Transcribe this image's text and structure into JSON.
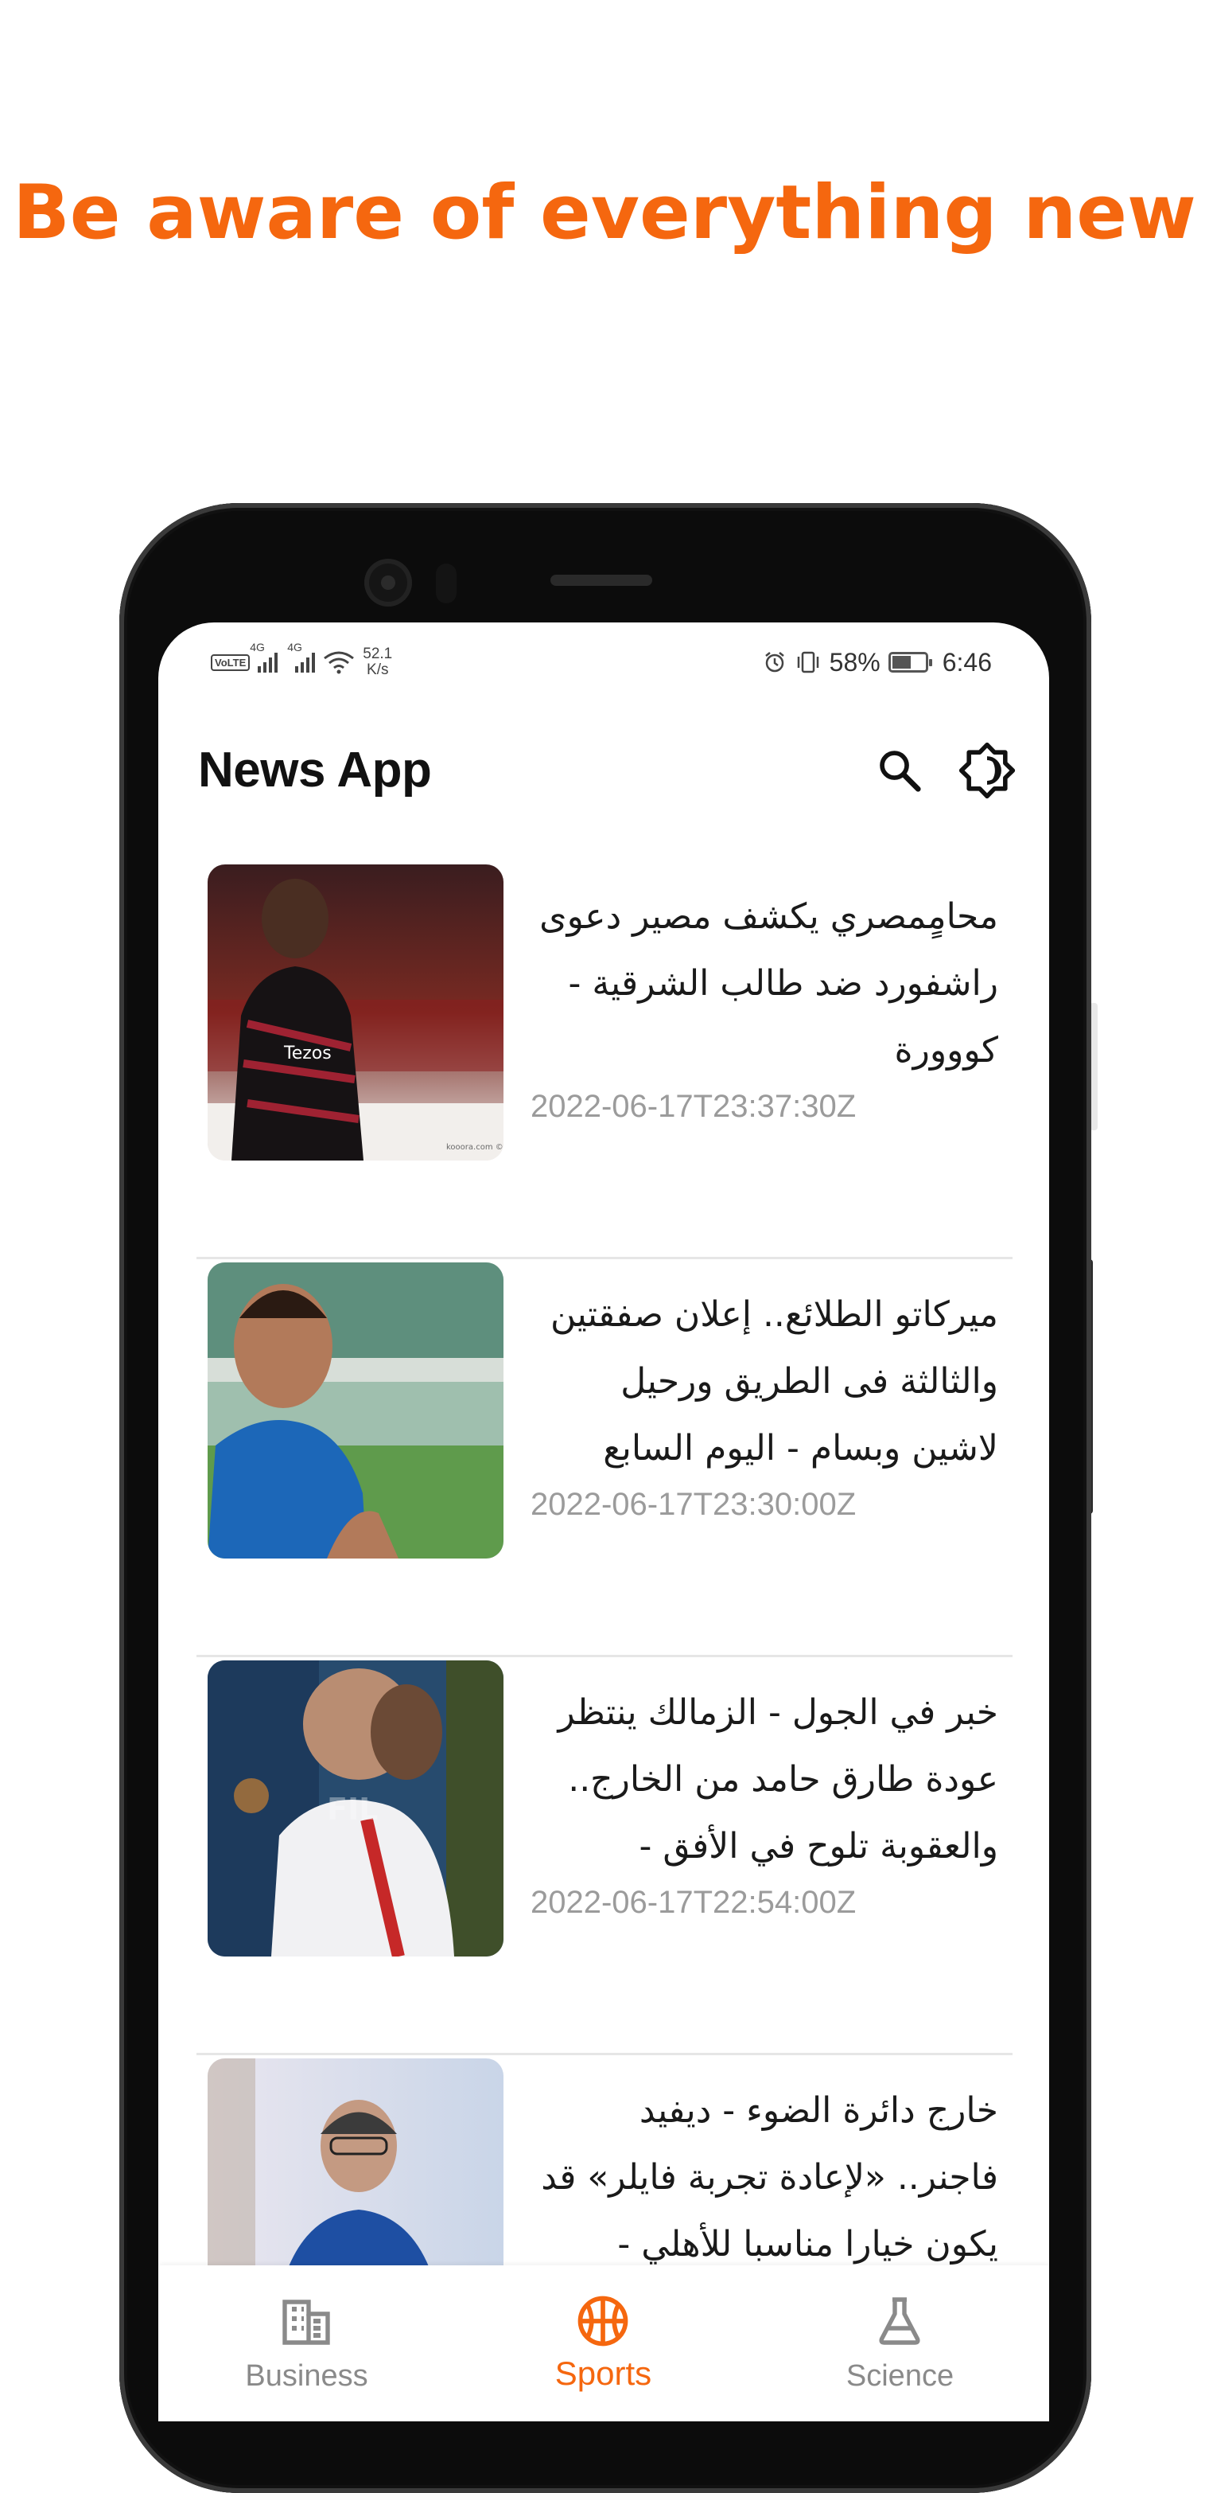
{
  "promo": {
    "headline": "Be aware of everything new"
  },
  "status_bar": {
    "volte": "VoLTE",
    "sim1": "4G",
    "sim2": "4G",
    "net_speed_value": "52.1",
    "net_speed_unit": "K/s",
    "battery_percent": "58%",
    "battery_level": 0.58,
    "time": "6:46",
    "icons": [
      "volte-icon",
      "signal-icon",
      "signal-icon",
      "wifi-icon",
      "alarm-icon",
      "vibrate-icon",
      "battery-icon"
    ]
  },
  "app_bar": {
    "title": "News App",
    "actions": [
      {
        "icon": "search-icon"
      },
      {
        "icon": "theme-toggle-icon"
      }
    ]
  },
  "articles": [
    {
      "title": "محامٍمصري يكشف مصير دعوى راشفورد ضد طالب الشرقية - كووورة",
      "date": "2022-06-17T23:37:30Z",
      "image_credit": "kooora.com © الأ"
    },
    {
      "title": "ميركاتو الطلائع.. إعلان صفقتين والثالثة فى الطريق ورحيل لاشين وبسام - اليوم السابع",
      "date": "2022-06-17T23:30:00Z"
    },
    {
      "title": "خبر في الجول - الزمالك ينتظر عودة طارق حامد من الخارج.. والعقوبة تلوح في الأفق -",
      "date": "2022-06-17T22:54:00Z"
    },
    {
      "title": "خارج دائرة الضوء - ديفيد فاجنر.. «لإعادة تجربة فايلر» قد يكون خيارا مناسبا للأهلي -",
      "date": ""
    }
  ],
  "bottom_nav": {
    "items": [
      {
        "label": "Business",
        "icon": "business-icon",
        "active": false
      },
      {
        "label": "Sports",
        "icon": "sports-ball-icon",
        "active": true
      },
      {
        "label": "Science",
        "icon": "science-flask-icon",
        "active": false
      }
    ]
  },
  "colors": {
    "accent": "#f5670f",
    "inactive": "#8a8a8a",
    "date_text": "#9b9b9b",
    "phone_frame": "#0c0c0c"
  }
}
